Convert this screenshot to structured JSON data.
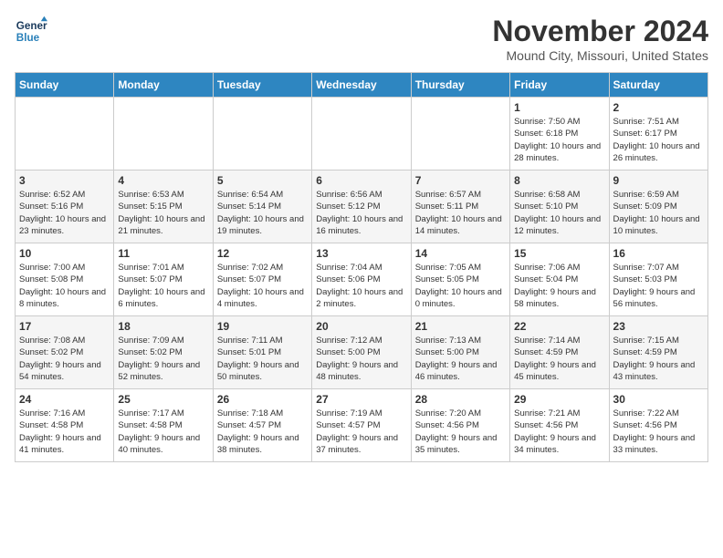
{
  "logo": {
    "line1": "General",
    "line2": "Blue"
  },
  "title": "November 2024",
  "location": "Mound City, Missouri, United States",
  "weekdays": [
    "Sunday",
    "Monday",
    "Tuesday",
    "Wednesday",
    "Thursday",
    "Friday",
    "Saturday"
  ],
  "weeks": [
    [
      {
        "day": "",
        "info": ""
      },
      {
        "day": "",
        "info": ""
      },
      {
        "day": "",
        "info": ""
      },
      {
        "day": "",
        "info": ""
      },
      {
        "day": "",
        "info": ""
      },
      {
        "day": "1",
        "info": "Sunrise: 7:50 AM\nSunset: 6:18 PM\nDaylight: 10 hours and 28 minutes."
      },
      {
        "day": "2",
        "info": "Sunrise: 7:51 AM\nSunset: 6:17 PM\nDaylight: 10 hours and 26 minutes."
      }
    ],
    [
      {
        "day": "3",
        "info": "Sunrise: 6:52 AM\nSunset: 5:16 PM\nDaylight: 10 hours and 23 minutes."
      },
      {
        "day": "4",
        "info": "Sunrise: 6:53 AM\nSunset: 5:15 PM\nDaylight: 10 hours and 21 minutes."
      },
      {
        "day": "5",
        "info": "Sunrise: 6:54 AM\nSunset: 5:14 PM\nDaylight: 10 hours and 19 minutes."
      },
      {
        "day": "6",
        "info": "Sunrise: 6:56 AM\nSunset: 5:12 PM\nDaylight: 10 hours and 16 minutes."
      },
      {
        "day": "7",
        "info": "Sunrise: 6:57 AM\nSunset: 5:11 PM\nDaylight: 10 hours and 14 minutes."
      },
      {
        "day": "8",
        "info": "Sunrise: 6:58 AM\nSunset: 5:10 PM\nDaylight: 10 hours and 12 minutes."
      },
      {
        "day": "9",
        "info": "Sunrise: 6:59 AM\nSunset: 5:09 PM\nDaylight: 10 hours and 10 minutes."
      }
    ],
    [
      {
        "day": "10",
        "info": "Sunrise: 7:00 AM\nSunset: 5:08 PM\nDaylight: 10 hours and 8 minutes."
      },
      {
        "day": "11",
        "info": "Sunrise: 7:01 AM\nSunset: 5:07 PM\nDaylight: 10 hours and 6 minutes."
      },
      {
        "day": "12",
        "info": "Sunrise: 7:02 AM\nSunset: 5:07 PM\nDaylight: 10 hours and 4 minutes."
      },
      {
        "day": "13",
        "info": "Sunrise: 7:04 AM\nSunset: 5:06 PM\nDaylight: 10 hours and 2 minutes."
      },
      {
        "day": "14",
        "info": "Sunrise: 7:05 AM\nSunset: 5:05 PM\nDaylight: 10 hours and 0 minutes."
      },
      {
        "day": "15",
        "info": "Sunrise: 7:06 AM\nSunset: 5:04 PM\nDaylight: 9 hours and 58 minutes."
      },
      {
        "day": "16",
        "info": "Sunrise: 7:07 AM\nSunset: 5:03 PM\nDaylight: 9 hours and 56 minutes."
      }
    ],
    [
      {
        "day": "17",
        "info": "Sunrise: 7:08 AM\nSunset: 5:02 PM\nDaylight: 9 hours and 54 minutes."
      },
      {
        "day": "18",
        "info": "Sunrise: 7:09 AM\nSunset: 5:02 PM\nDaylight: 9 hours and 52 minutes."
      },
      {
        "day": "19",
        "info": "Sunrise: 7:11 AM\nSunset: 5:01 PM\nDaylight: 9 hours and 50 minutes."
      },
      {
        "day": "20",
        "info": "Sunrise: 7:12 AM\nSunset: 5:00 PM\nDaylight: 9 hours and 48 minutes."
      },
      {
        "day": "21",
        "info": "Sunrise: 7:13 AM\nSunset: 5:00 PM\nDaylight: 9 hours and 46 minutes."
      },
      {
        "day": "22",
        "info": "Sunrise: 7:14 AM\nSunset: 4:59 PM\nDaylight: 9 hours and 45 minutes."
      },
      {
        "day": "23",
        "info": "Sunrise: 7:15 AM\nSunset: 4:59 PM\nDaylight: 9 hours and 43 minutes."
      }
    ],
    [
      {
        "day": "24",
        "info": "Sunrise: 7:16 AM\nSunset: 4:58 PM\nDaylight: 9 hours and 41 minutes."
      },
      {
        "day": "25",
        "info": "Sunrise: 7:17 AM\nSunset: 4:58 PM\nDaylight: 9 hours and 40 minutes."
      },
      {
        "day": "26",
        "info": "Sunrise: 7:18 AM\nSunset: 4:57 PM\nDaylight: 9 hours and 38 minutes."
      },
      {
        "day": "27",
        "info": "Sunrise: 7:19 AM\nSunset: 4:57 PM\nDaylight: 9 hours and 37 minutes."
      },
      {
        "day": "28",
        "info": "Sunrise: 7:20 AM\nSunset: 4:56 PM\nDaylight: 9 hours and 35 minutes."
      },
      {
        "day": "29",
        "info": "Sunrise: 7:21 AM\nSunset: 4:56 PM\nDaylight: 9 hours and 34 minutes."
      },
      {
        "day": "30",
        "info": "Sunrise: 7:22 AM\nSunset: 4:56 PM\nDaylight: 9 hours and 33 minutes."
      }
    ]
  ]
}
